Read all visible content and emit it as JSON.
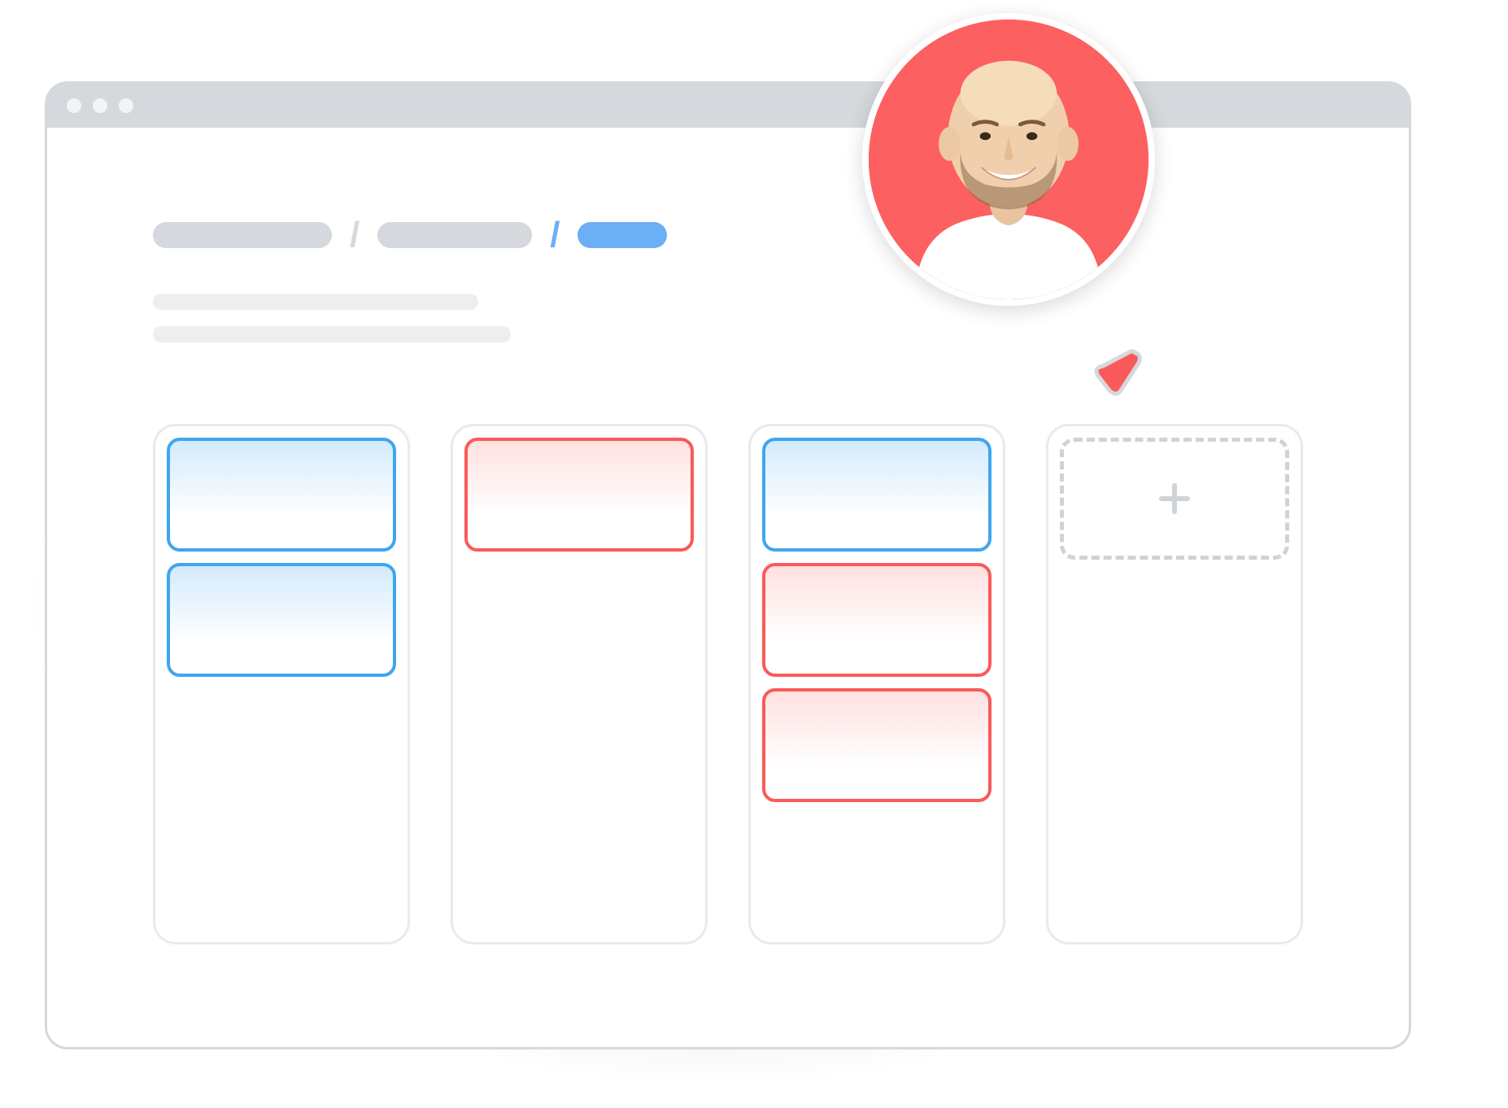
{
  "window": {
    "traffic_lights": 3
  },
  "breadcrumb": {
    "segments": [
      {
        "active": false
      },
      {
        "active": false
      },
      {
        "active": true
      }
    ]
  },
  "description_lines": 2,
  "colors": {
    "blue": "#3fa6ee",
    "red": "#fa5a5a",
    "accent_blue": "#6bb0f4",
    "neutral": "#d5d8dc",
    "avatar_bg": "#fc6060"
  },
  "board": {
    "columns": [
      {
        "cards": [
          {
            "color": "blue"
          },
          {
            "color": "blue"
          }
        ]
      },
      {
        "cards": [
          {
            "color": "red"
          }
        ]
      },
      {
        "cards": [
          {
            "color": "blue"
          },
          {
            "color": "red"
          },
          {
            "color": "red"
          }
        ]
      },
      {
        "add_placeholder": true,
        "add_label": "+"
      }
    ]
  },
  "avatar": {
    "present": true
  },
  "cursor": {
    "present": true,
    "color": "#fa5a5a"
  }
}
